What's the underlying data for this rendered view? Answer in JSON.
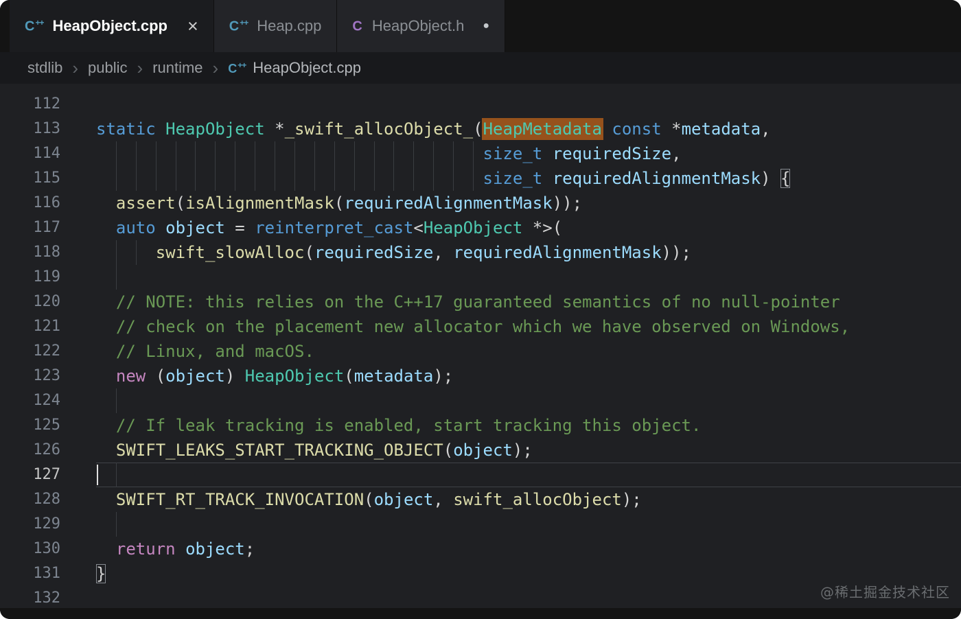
{
  "window": {
    "tabs": [
      {
        "label": "HeapObject.cpp",
        "file_type": "cpp",
        "state": "active",
        "close_label": "×"
      },
      {
        "label": "Heap.cpp",
        "file_type": "cpp",
        "state": "inactive"
      },
      {
        "label": "HeapObject.h",
        "file_type": "h",
        "state": "inactive",
        "modified_indicator": "●"
      }
    ],
    "breadcrumb": {
      "separator": "›",
      "items": [
        "stdlib",
        "public",
        "runtime"
      ],
      "file": "HeapObject.cpp"
    }
  },
  "icons": {
    "cpp": {
      "base": "C",
      "sup": "++"
    },
    "h": {
      "base": "C",
      "sup": ""
    }
  },
  "editor": {
    "language": "cpp",
    "first_visible_line": 112,
    "last_visible_line": 132,
    "active_line": 127,
    "highlighted_word": "HeapMetadata",
    "lines": [
      {
        "n": 112,
        "t": []
      },
      {
        "n": 113,
        "t": [
          [
            "kw",
            "static"
          ],
          [
            "pl",
            " "
          ],
          [
            "type",
            "HeapObject"
          ],
          [
            "pl",
            " *"
          ],
          [
            "fn",
            "_swift_allocObject_"
          ],
          [
            "pl",
            "("
          ],
          [
            "hl",
            "HeapMetadata"
          ],
          [
            "pl",
            " "
          ],
          [
            "kw",
            "const"
          ],
          [
            "pl",
            " *"
          ],
          [
            "var",
            "metadata"
          ],
          [
            "pl",
            ","
          ]
        ]
      },
      {
        "n": 114,
        "t": [
          [
            "sp",
            39
          ],
          [
            "kw",
            "size_t"
          ],
          [
            "pl",
            " "
          ],
          [
            "var",
            "requiredSize"
          ],
          [
            "pl",
            ","
          ]
        ],
        "g": [
          2,
          4,
          6,
          8,
          10,
          12,
          14,
          16,
          18,
          20,
          22,
          24,
          26,
          28,
          30,
          32,
          34,
          36,
          38
        ]
      },
      {
        "n": 115,
        "t": [
          [
            "sp",
            39
          ],
          [
            "kw",
            "size_t"
          ],
          [
            "pl",
            " "
          ],
          [
            "var",
            "requiredAlignmentMask"
          ],
          [
            "pl",
            ") "
          ],
          [
            "bm",
            "{"
          ]
        ],
        "g": [
          2,
          4,
          6,
          8,
          10,
          12,
          14,
          16,
          18,
          20,
          22,
          24,
          26,
          28,
          30,
          32,
          34,
          36,
          38
        ]
      },
      {
        "n": 116,
        "t": [
          [
            "sp",
            2
          ],
          [
            "fn",
            "assert"
          ],
          [
            "pl",
            "("
          ],
          [
            "fn",
            "isAlignmentMask"
          ],
          [
            "pl",
            "("
          ],
          [
            "var",
            "requiredAlignmentMask"
          ],
          [
            "pl",
            "));"
          ]
        ]
      },
      {
        "n": 117,
        "t": [
          [
            "sp",
            2
          ],
          [
            "kw",
            "auto"
          ],
          [
            "pl",
            " "
          ],
          [
            "var",
            "object"
          ],
          [
            "pl",
            " = "
          ],
          [
            "kw",
            "reinterpret_cast"
          ],
          [
            "pl",
            "<"
          ],
          [
            "type",
            "HeapObject"
          ],
          [
            "pl",
            " *>("
          ]
        ]
      },
      {
        "n": 118,
        "t": [
          [
            "sp",
            6
          ],
          [
            "fn",
            "swift_slowAlloc"
          ],
          [
            "pl",
            "("
          ],
          [
            "var",
            "requiredSize"
          ],
          [
            "pl",
            ", "
          ],
          [
            "var",
            "requiredAlignmentMask"
          ],
          [
            "pl",
            "));"
          ]
        ],
        "g": [
          2,
          4
        ]
      },
      {
        "n": 119,
        "t": [],
        "g": [
          2
        ]
      },
      {
        "n": 120,
        "t": [
          [
            "sp",
            2
          ],
          [
            "cm",
            "// NOTE: this relies on the C++17 guaranteed semantics of no null-pointer"
          ]
        ]
      },
      {
        "n": 121,
        "t": [
          [
            "sp",
            2
          ],
          [
            "cm",
            "// check on the placement new allocator which we have observed on Windows,"
          ]
        ]
      },
      {
        "n": 122,
        "t": [
          [
            "sp",
            2
          ],
          [
            "cm",
            "// Linux, and macOS."
          ]
        ]
      },
      {
        "n": 123,
        "t": [
          [
            "sp",
            2
          ],
          [
            "ctrl",
            "new"
          ],
          [
            "pl",
            " ("
          ],
          [
            "var",
            "object"
          ],
          [
            "pl",
            ") "
          ],
          [
            "type",
            "HeapObject"
          ],
          [
            "pl",
            "("
          ],
          [
            "var",
            "metadata"
          ],
          [
            "pl",
            ");"
          ]
        ]
      },
      {
        "n": 124,
        "t": [],
        "g": [
          2
        ]
      },
      {
        "n": 125,
        "t": [
          [
            "sp",
            2
          ],
          [
            "cm",
            "// If leak tracking is enabled, start tracking this object."
          ]
        ]
      },
      {
        "n": 126,
        "t": [
          [
            "sp",
            2
          ],
          [
            "fn",
            "SWIFT_LEAKS_START_TRACKING_OBJECT"
          ],
          [
            "pl",
            "("
          ],
          [
            "var",
            "object"
          ],
          [
            "pl",
            ");"
          ]
        ]
      },
      {
        "n": 127,
        "t": [],
        "g": [
          2
        ],
        "cursor": true
      },
      {
        "n": 128,
        "t": [
          [
            "sp",
            2
          ],
          [
            "fn",
            "SWIFT_RT_TRACK_INVOCATION"
          ],
          [
            "pl",
            "("
          ],
          [
            "var",
            "object"
          ],
          [
            "pl",
            ", "
          ],
          [
            "fn",
            "swift_allocObject"
          ],
          [
            "pl",
            ");"
          ]
        ]
      },
      {
        "n": 129,
        "t": [],
        "g": [
          2
        ]
      },
      {
        "n": 130,
        "t": [
          [
            "sp",
            2
          ],
          [
            "ctrl",
            "return"
          ],
          [
            "pl",
            " "
          ],
          [
            "var",
            "object"
          ],
          [
            "pl",
            ";"
          ]
        ]
      },
      {
        "n": 131,
        "t": [
          [
            "bm",
            "}"
          ]
        ]
      },
      {
        "n": 132,
        "t": []
      }
    ]
  },
  "watermark": "@稀土掘金技术社区",
  "colors": {
    "editor_bg": "#1f2023",
    "chrome_bg": "#141414",
    "tab_inactive_bg": "#232428",
    "tab_active_bg": "#1b1c1f",
    "breadcrumb_bg": "#18191c",
    "kw": "#569cd6",
    "type": "#4ec9b0",
    "fn": "#dcdcaa",
    "var": "#9cdcfe",
    "pl": "#d4d4d4",
    "cm": "#6a9955",
    "ctrl": "#c586c0",
    "match_bg": "#96521c",
    "line_number": "#7d8590",
    "line_number_active": "#c6c6c6",
    "icon_cpp": "#519aba",
    "icon_h": "#a074c4",
    "guide": "#3a3d41",
    "current_line_border": "#3f4247",
    "cursor": "#e0e0e0",
    "watermark_color": "#6a6d70"
  }
}
